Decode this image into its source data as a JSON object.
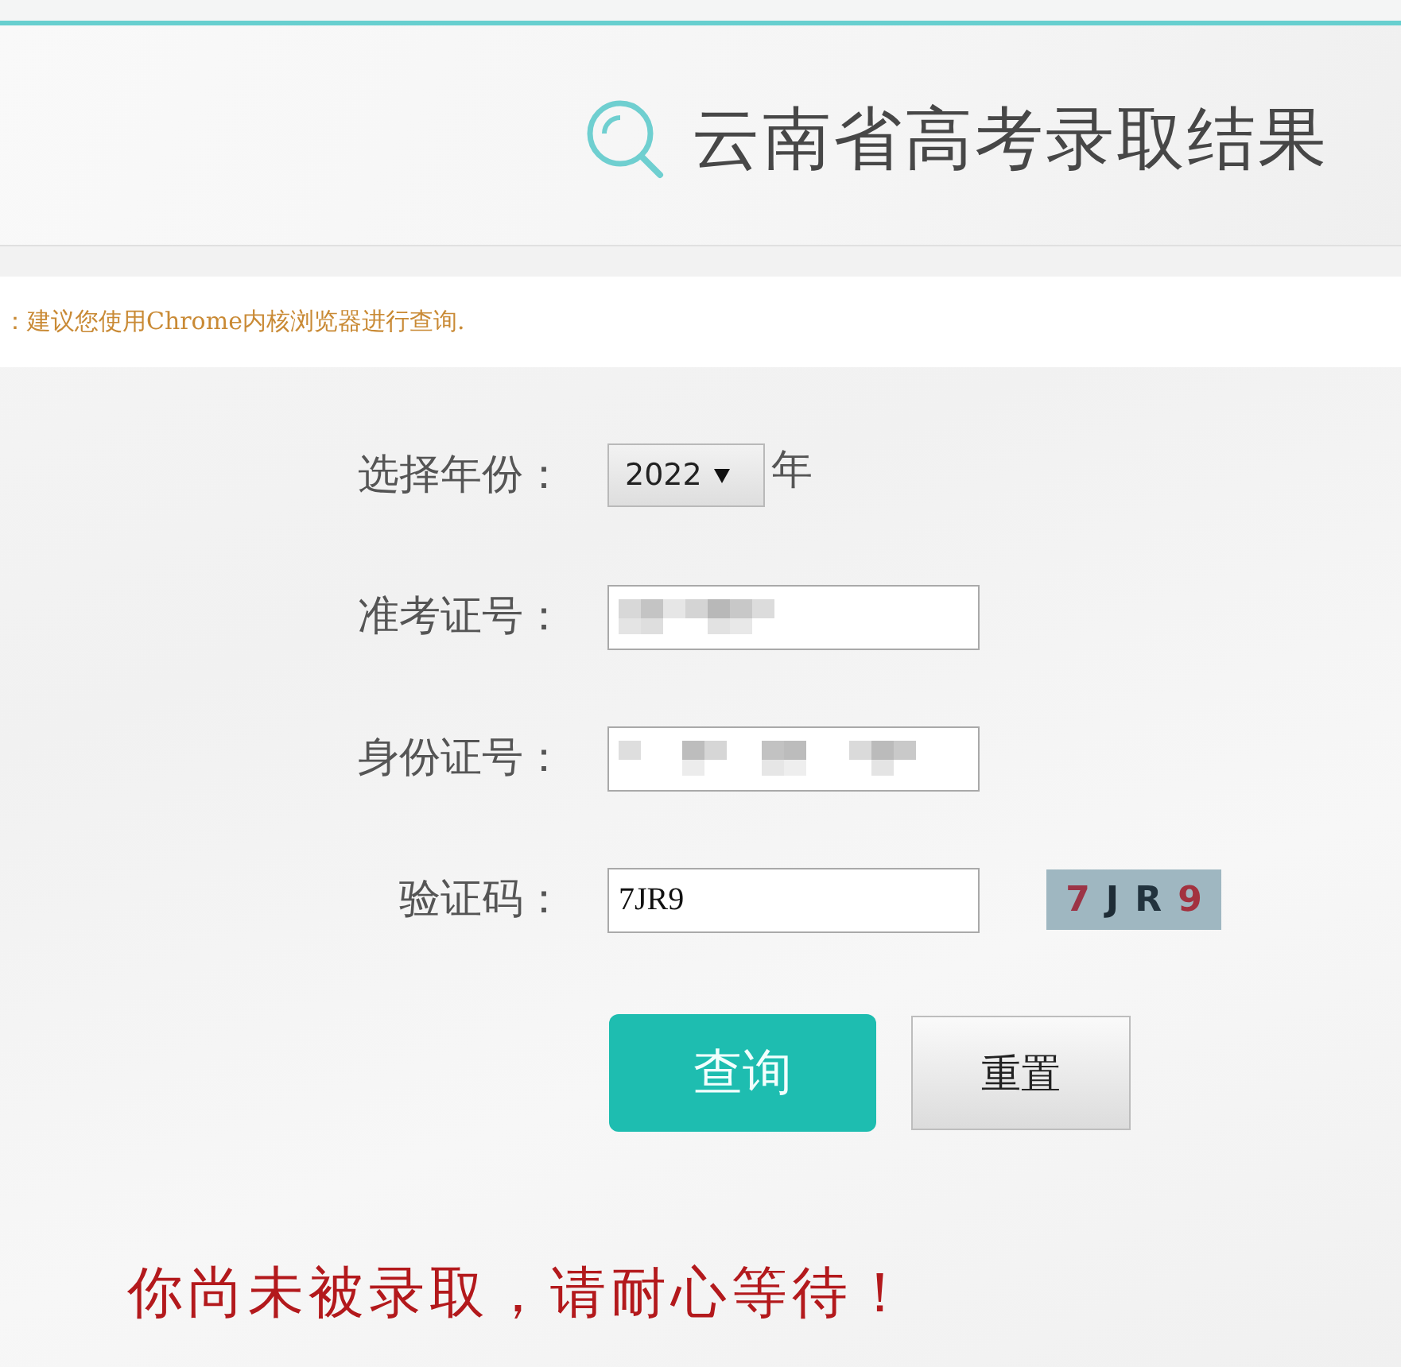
{
  "header": {
    "title": "云南省高考录取结果"
  },
  "notice": {
    "text": "：建议您使用Chrome内核浏览器进行查询."
  },
  "form": {
    "rows": [
      {
        "kind": "select",
        "label": "选择年份：",
        "value": "2022",
        "suffix": "年"
      },
      {
        "kind": "redacted",
        "label": "准考证号："
      },
      {
        "kind": "redacted",
        "label": "身份证号："
      },
      {
        "kind": "captcha",
        "label": "验证码：",
        "value": "7JR9",
        "captcha": [
          {
            "text": "7",
            "color": "#9c3446"
          },
          {
            "text": "J",
            "color": "#1e2c36"
          },
          {
            "text": "R",
            "color": "#22333e"
          },
          {
            "text": "9",
            "color": "#a3323f"
          }
        ]
      }
    ]
  },
  "buttons": [
    {
      "kind": "primary",
      "label": "查询"
    },
    {
      "kind": "secondary",
      "label": "重置"
    }
  ],
  "result": {
    "message": "你尚未被录取，请耐心等待！"
  }
}
